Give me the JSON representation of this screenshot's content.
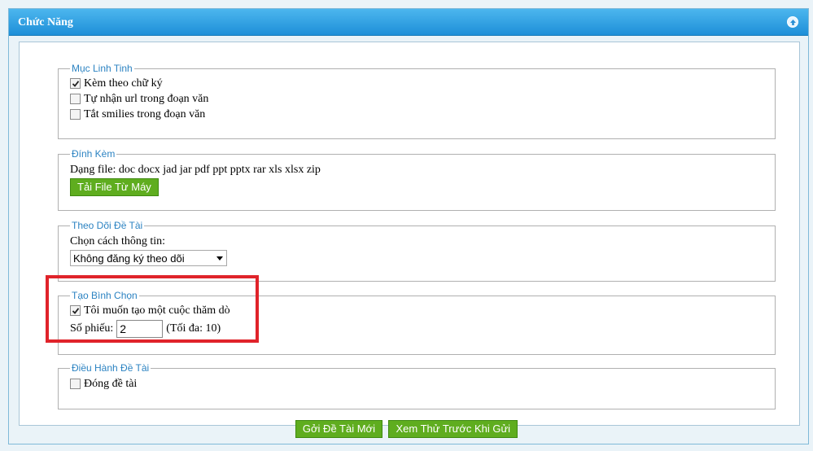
{
  "panel": {
    "title": "Chức Năng",
    "collapse_icon": "collapse-up-icon"
  },
  "misc": {
    "legend": "Mục Linh Tinh",
    "options": [
      {
        "label": "Kèm theo chữ ký",
        "checked": true
      },
      {
        "label": "Tự nhận url trong đoạn văn",
        "checked": false
      },
      {
        "label": "Tắt smilies trong đoạn văn",
        "checked": false
      }
    ]
  },
  "attach": {
    "legend": "Đính Kèm",
    "file_types": "Dạng file: doc docx jad jar pdf ppt pptx rar xls xlsx zip",
    "upload_button": "Tải File Từ Máy"
  },
  "follow": {
    "legend": "Theo Dõi Đề Tài",
    "label": "Chọn cách thông tin:",
    "selected": "Không đăng ký theo dõi"
  },
  "poll": {
    "legend": "Tạo Bình Chọn",
    "create_label": "Tôi muốn tạo một cuộc thăm dò",
    "create_checked": true,
    "votes_label": "Số phiếu:",
    "votes_value": "2",
    "max_note": "(Tối đa: 10)"
  },
  "moderate": {
    "legend": "Điều Hành Đề Tài",
    "close_label": "Đóng đề tài",
    "close_checked": false
  },
  "actions": {
    "submit": "Gởi Đề Tài Mới",
    "preview": "Xem Thử Trước Khi Gửi"
  },
  "colors": {
    "header": "#1e8fd8",
    "legend": "#2c83c2",
    "button": "#5fad1f",
    "highlight": "#e0232a"
  }
}
